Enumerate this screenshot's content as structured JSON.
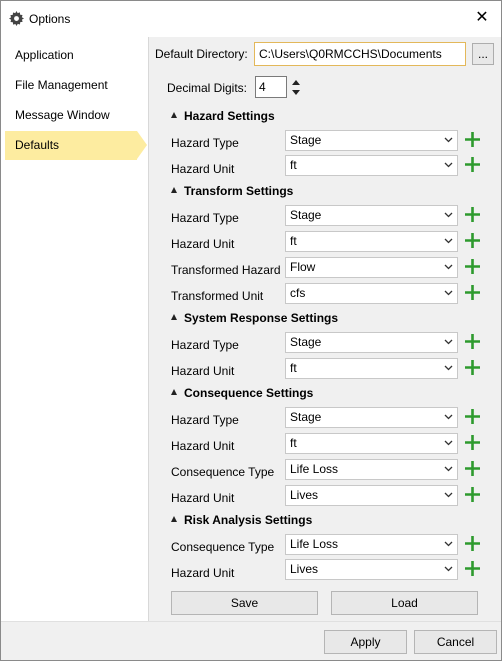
{
  "window": {
    "title": "Options",
    "icon": "gear-icon",
    "close_label": "✕"
  },
  "sidebar": {
    "items": [
      {
        "label": "Application",
        "active": false
      },
      {
        "label": "File Management",
        "active": false
      },
      {
        "label": "Message Window",
        "active": false
      },
      {
        "label": "Defaults",
        "active": true
      }
    ]
  },
  "general": {
    "default_directory_label": "Default Directory:",
    "default_directory_value": "C:\\Users\\Q0RMCCHS\\Documents",
    "browse_label": "...",
    "decimal_digits_label": "Decimal Digits:",
    "decimal_digits_value": "4"
  },
  "sections": {
    "hazard": {
      "title": "Hazard Settings",
      "type_label": "Hazard Type",
      "type_value": "Stage",
      "unit_label": "Hazard Unit",
      "unit_value": "ft"
    },
    "transform": {
      "title": "Transform Settings",
      "type_label": "Hazard Type",
      "type_value": "Stage",
      "unit_label": "Hazard Unit",
      "unit_value": "ft",
      "thazard_label": "Transformed Hazard",
      "thazard_value": "Flow",
      "tunit_label": "Transformed Unit",
      "tunit_value": "cfs"
    },
    "system_response": {
      "title": "System Response Settings",
      "type_label": "Hazard Type",
      "type_value": "Stage",
      "unit_label": "Hazard Unit",
      "unit_value": "ft"
    },
    "consequence": {
      "title": "Consequence Settings",
      "type_label": "Hazard Type",
      "type_value": "Stage",
      "unit_label": "Hazard Unit",
      "unit_value": "ft",
      "ctype_label": "Consequence Type",
      "ctype_value": "Life Loss",
      "cunit_label": "Hazard Unit",
      "cunit_value": "Lives"
    },
    "risk": {
      "title": "Risk Analysis Settings",
      "ctype_label": "Consequence Type",
      "ctype_value": "Life Loss",
      "unit_label": "Hazard Unit",
      "unit_value": "Lives"
    }
  },
  "buttons": {
    "save": "Save",
    "load": "Load",
    "apply": "Apply",
    "cancel": "Cancel"
  },
  "colors": {
    "accent_selected": "#fdeca0",
    "plus_green": "#2e9a2e",
    "directory_border": "#e3b85a"
  }
}
